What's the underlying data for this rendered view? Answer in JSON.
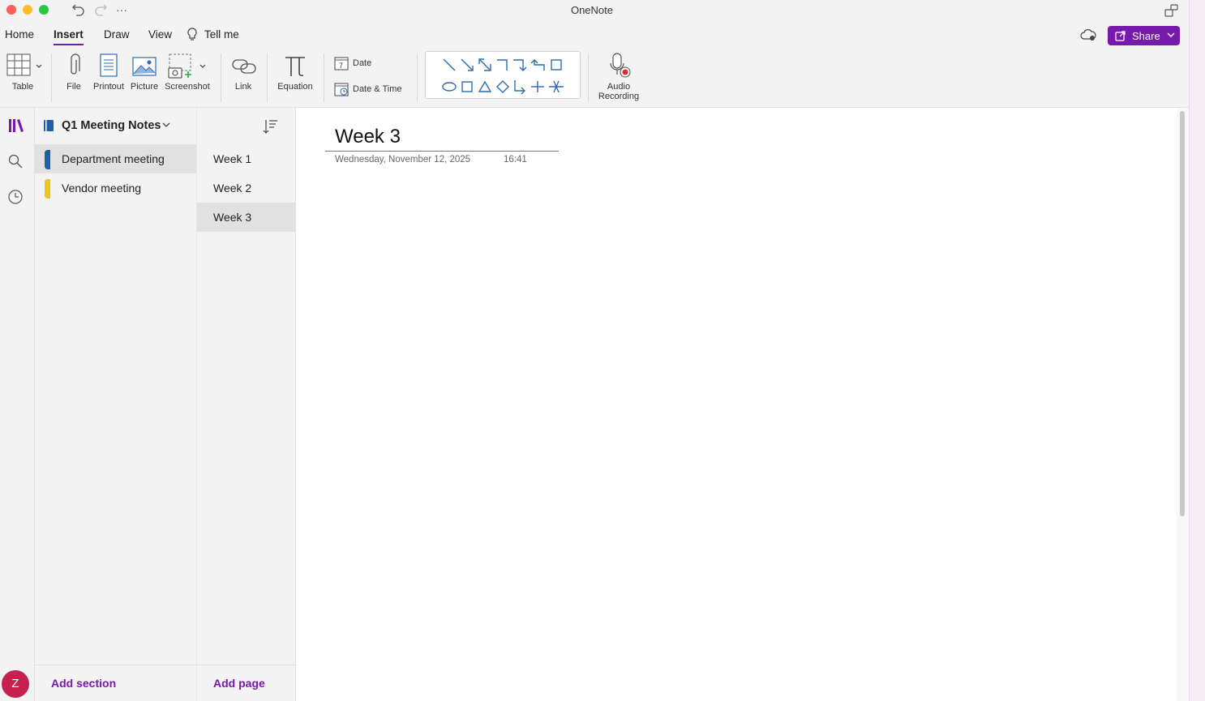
{
  "window": {
    "title": "OneNote"
  },
  "tabs": [
    {
      "label": "Home"
    },
    {
      "label": "Insert"
    },
    {
      "label": "Draw"
    },
    {
      "label": "View"
    },
    {
      "label": "Tell me"
    }
  ],
  "share": {
    "label": "Share"
  },
  "ribbon": {
    "table": "Table",
    "file": "File",
    "printout": "Printout",
    "picture": "Picture",
    "screenshot": "Screenshot",
    "link": "Link",
    "equation": "Equation",
    "date": "Date",
    "date_time": "Date & Time",
    "audio_line1": "Audio",
    "audio_line2": "Recording"
  },
  "notebook": {
    "name": "Q1 Meeting Notes"
  },
  "sections": [
    {
      "label": "Department meeting",
      "color": "#1f5fa8"
    },
    {
      "label": "Vendor meeting",
      "color": "#f2c21b"
    }
  ],
  "pages": [
    {
      "label": "Week 1"
    },
    {
      "label": "Week 2"
    },
    {
      "label": "Week 3"
    }
  ],
  "add_section": "Add section",
  "add_page": "Add page",
  "page": {
    "title": "Week 3",
    "date": "Wednesday, November 12, 2025",
    "time": "16:41"
  },
  "user": {
    "initial": "Z"
  },
  "colors": {
    "accent": "#7719aa",
    "shape_blue": "#2b6cb3"
  }
}
